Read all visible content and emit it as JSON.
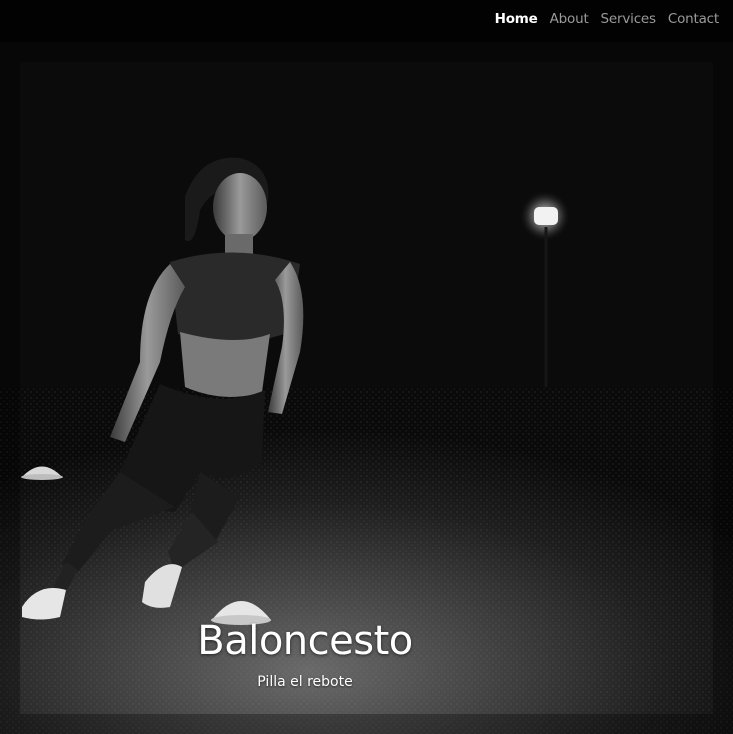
{
  "nav": {
    "items": [
      {
        "label": "Home",
        "active": true
      },
      {
        "label": "About",
        "active": false
      },
      {
        "label": "Services",
        "active": false
      },
      {
        "label": "Contact",
        "active": false
      }
    ]
  },
  "hero": {
    "title": "Baloncesto",
    "subtitle": "Pilla el rebote"
  },
  "colors": {
    "background": "#000000",
    "nav_active": "#ffffff",
    "nav_inactive": "#9a9a9a",
    "text": "#ffffff"
  }
}
